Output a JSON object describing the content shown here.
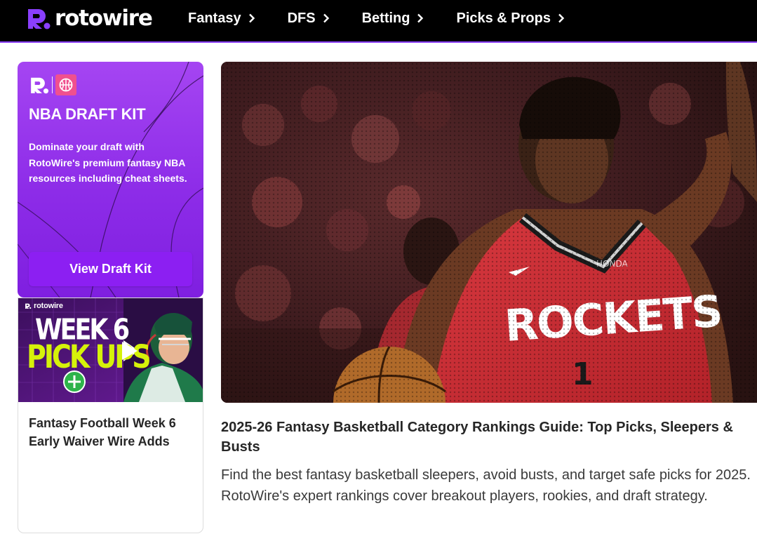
{
  "header": {
    "brand": "rotowire",
    "nav": [
      {
        "label": "Fantasy"
      },
      {
        "label": "DFS"
      },
      {
        "label": "Betting"
      },
      {
        "label": "Picks & Props"
      }
    ],
    "accent_color": "#8a3ffc"
  },
  "promo": {
    "title": "NBA DRAFT KIT",
    "text": "Dominate your draft with RotoWire's premium fantasy NBA resources including cheat sheets.",
    "button_label": "View Draft Kit",
    "colors": {
      "background": "#9a3bee",
      "button": "#8c1ff2",
      "badge": "#f0508f"
    },
    "icons": [
      "rotowire-logo-icon",
      "basketball-icon"
    ]
  },
  "side_article": {
    "thumbnail": {
      "brand": "rotowire",
      "line1": "WEEK 6",
      "line2": "PICK UPS",
      "icons": [
        "play-icon",
        "plus-icon"
      ]
    },
    "title": "Fantasy Football Week 6 Early Waiver Wire Adds"
  },
  "main_article": {
    "image": {
      "jersey_text": "ROCKETS",
      "jersey_number": "1",
      "sponsor": "HONDA"
    },
    "title": "2025-26 Fantasy Basketball Category Rankings Guide: Top Picks, Sleepers & Busts",
    "description": "Find the best fantasy basketball sleepers, avoid busts, and target safe picks for 2025. RotoWire's expert rankings cover breakout players, rookies, and draft strategy."
  }
}
